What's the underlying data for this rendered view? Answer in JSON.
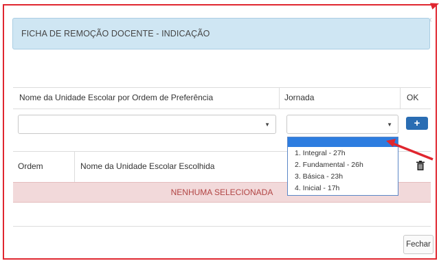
{
  "modal": {
    "title": "FICHA DE REMOÇÃO DOCENTE - INDICAÇÃO",
    "close_glyph": "×"
  },
  "form_table": {
    "headers": [
      "Nome da Unidade Escolar por Ordem de Preferência",
      "Jornada",
      "OK"
    ],
    "school_select": {
      "value": ""
    },
    "jornada_select": {
      "value": ""
    },
    "add_button_label": "+"
  },
  "jornada_dropdown": {
    "options": [
      "1. Integral - 27h",
      "2. Fundamental - 26h",
      "3. Básica - 23h",
      "4. Inicial - 17h"
    ],
    "highlight_color": "#2d7de0"
  },
  "chosen_table": {
    "headers": [
      "Ordem",
      "Nome da Unidade Escolar Escolhida"
    ],
    "empty_message": "NENHUMA SELECIONADA"
  },
  "footer": {
    "close_button_label": "Fechar"
  },
  "colors": {
    "annotation_red": "#e0262f",
    "header_panel_bg": "#cfe6f3",
    "button_blue": "#2a6db3",
    "empty_row_bg": "#f2d9da",
    "empty_text": "#b14544"
  }
}
